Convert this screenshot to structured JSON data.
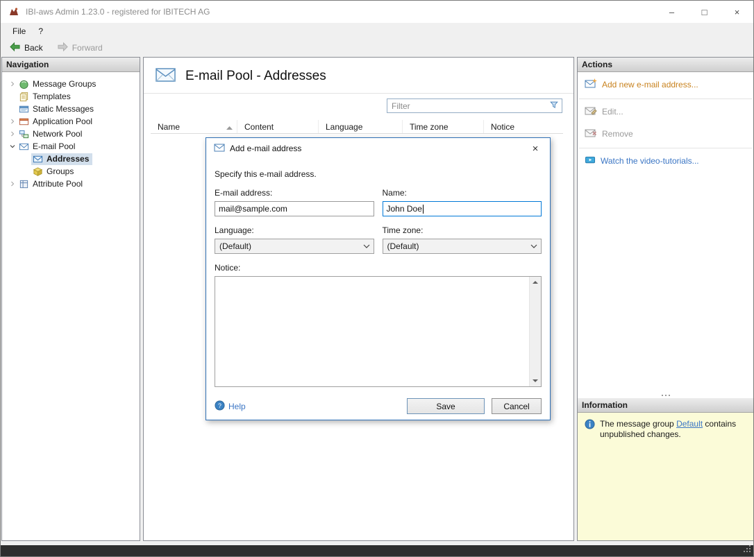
{
  "window": {
    "title": "IBI-aws Admin 1.23.0 - registered for IBITECH AG",
    "minimize": "–",
    "maximize": "□",
    "close": "×"
  },
  "menu": {
    "file": "File",
    "help": "?"
  },
  "toolbar": {
    "back": "Back",
    "forward": "Forward"
  },
  "navigation": {
    "header": "Navigation",
    "items": [
      {
        "label": "Message Groups"
      },
      {
        "label": "Templates"
      },
      {
        "label": "Static Messages"
      },
      {
        "label": "Application Pool"
      },
      {
        "label": "Network Pool"
      },
      {
        "label": "E-mail Pool"
      },
      {
        "label": "Addresses"
      },
      {
        "label": "Groups"
      },
      {
        "label": "Attribute Pool"
      }
    ]
  },
  "main": {
    "title": "E-mail Pool - Addresses",
    "filter_placeholder": "Filter",
    "columns": {
      "name": "Name",
      "content": "Content",
      "language": "Language",
      "timezone": "Time zone",
      "notice": "Notice"
    }
  },
  "dialog": {
    "title": "Add e-mail address",
    "close": "×",
    "description": "Specify this e-mail address.",
    "fields": {
      "email_label": "E-mail address:",
      "email_value": "mail@sample.com",
      "name_label": "Name:",
      "name_value": "John Doe",
      "language_label": "Language:",
      "language_value": "(Default)",
      "timezone_label": "Time zone:",
      "timezone_value": "(Default)",
      "notice_label": "Notice:"
    },
    "help": "Help",
    "save": "Save",
    "cancel": "Cancel"
  },
  "actions": {
    "header": "Actions",
    "add": "Add new e-mail address...",
    "edit": "Edit...",
    "remove": "Remove",
    "tutorials": "Watch the video-tutorials..."
  },
  "information": {
    "header": "Information",
    "text_before": "The message group ",
    "link": "Default",
    "text_after": " contains unpublished changes."
  },
  "icons": {
    "filter": "funnel",
    "sort_name": "triangle-up-ascending",
    "help": "blue-question-circle",
    "info": "blue-info-circle",
    "back": "green-left-arrow",
    "forward": "gray-right-arrow",
    "page": "envelope"
  },
  "colors": {
    "dialog_border": "#2e6fb5",
    "focus_border": "#0078d7",
    "action_enabled": "#c8821e",
    "action_disabled": "#9a9a9a",
    "link": "#3a75c4",
    "info_bg": "#fbfbd8",
    "selection_bg": "#d2dfec",
    "statusbar_bg": "#2e2e2e"
  }
}
